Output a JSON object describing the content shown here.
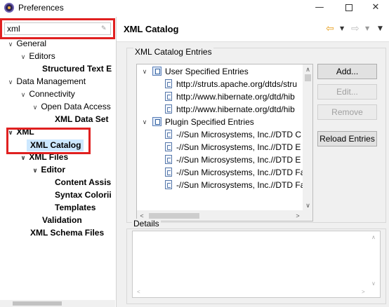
{
  "window": {
    "title": "Preferences",
    "minimize": "—",
    "close": "✕"
  },
  "filter": {
    "value": "xml"
  },
  "tree": {
    "items": [
      {
        "label": "General",
        "chevron": "∨"
      },
      {
        "label": "Editors",
        "chevron": "∨"
      },
      {
        "label": "Structured Text E"
      },
      {
        "label": "Data Management",
        "chevron": "∨"
      },
      {
        "label": "Connectivity",
        "chevron": "∨"
      },
      {
        "label": "Open Data Access",
        "chevron": "∨"
      },
      {
        "label": "XML Data Set"
      },
      {
        "label": "XML",
        "chevron": "∨"
      },
      {
        "label": "XML Catalog"
      },
      {
        "label": "XML Files",
        "chevron": "∨"
      },
      {
        "label": "Editor",
        "chevron": "∨"
      },
      {
        "label": "Content Assis"
      },
      {
        "label": "Syntax Colorii"
      },
      {
        "label": "Templates"
      },
      {
        "label": "Validation"
      },
      {
        "label": "XML Schema Files"
      }
    ]
  },
  "page": {
    "title": "XML Catalog",
    "nav": {
      "back_icon": "back-arrow-icon",
      "forward_icon": "forward-arrow-icon",
      "menu_icon": "view-menu-icon"
    },
    "entries_label": "XML Catalog Entries",
    "details_label": "Details"
  },
  "catalog": {
    "user_group": "User Specified Entries",
    "user_entries": [
      "http://struts.apache.org/dtds/stru",
      "http://www.hibernate.org/dtd/hib",
      "http://www.hibernate.org/dtd/hib"
    ],
    "plugin_group": "Plugin Specified Entries",
    "plugin_entries": [
      "-//Sun Microsystems, Inc.//DTD C",
      "-//Sun Microsystems, Inc.//DTD E",
      "-//Sun Microsystems, Inc.//DTD E",
      "-//Sun Microsystems, Inc.//DTD Fa",
      "-//Sun Microsystems, Inc.//DTD Fa"
    ]
  },
  "buttons": {
    "add": "Add...",
    "edit": "Edit...",
    "remove": "Remove",
    "reload": "Reload Entries"
  },
  "colors": {
    "highlight_border": "#e02020",
    "selection": "#cde8ff",
    "back_arrow": "#e8a020"
  }
}
